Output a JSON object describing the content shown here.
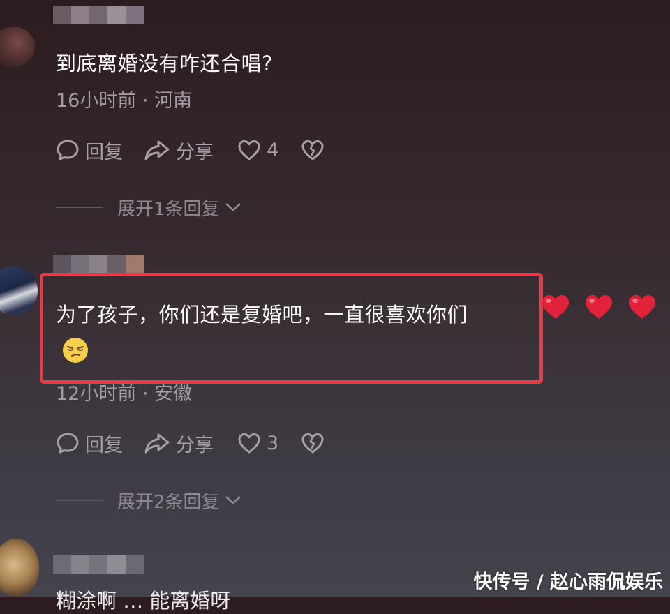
{
  "comments": [
    {
      "text": "到底离婚没有咋还合唱?",
      "meta": "16小时前 · 河南",
      "reply_label": "回复",
      "share_label": "分享",
      "likes": "4",
      "expand_label": "展开1条回复"
    },
    {
      "text": "为了孩子，你们还是复婚吧，一直很喜欢你们",
      "meta": "12小时前 · 安徽",
      "reply_label": "回复",
      "share_label": "分享",
      "likes": "3",
      "expand_label": "展开2条回复"
    },
    {
      "text_partial": "糊涂啊 … 能离婚呀"
    }
  ],
  "watermark": "快传号 / 赵心雨侃娱乐",
  "colors": {
    "highlight_border": "#ec3944",
    "heart_red": "#e2213a",
    "text_primary": "#ffffff",
    "text_secondary": "#a29ca3"
  },
  "icons": {
    "reply": "chat-bubble-icon",
    "share": "share-arrow-icon",
    "like": "heart-outline-icon",
    "dislike": "broken-heart-icon",
    "expand": "chevron-down-icon",
    "hearts_emoji": "red-heart-emoji",
    "face_emoji": "smirk-face-emoji"
  }
}
